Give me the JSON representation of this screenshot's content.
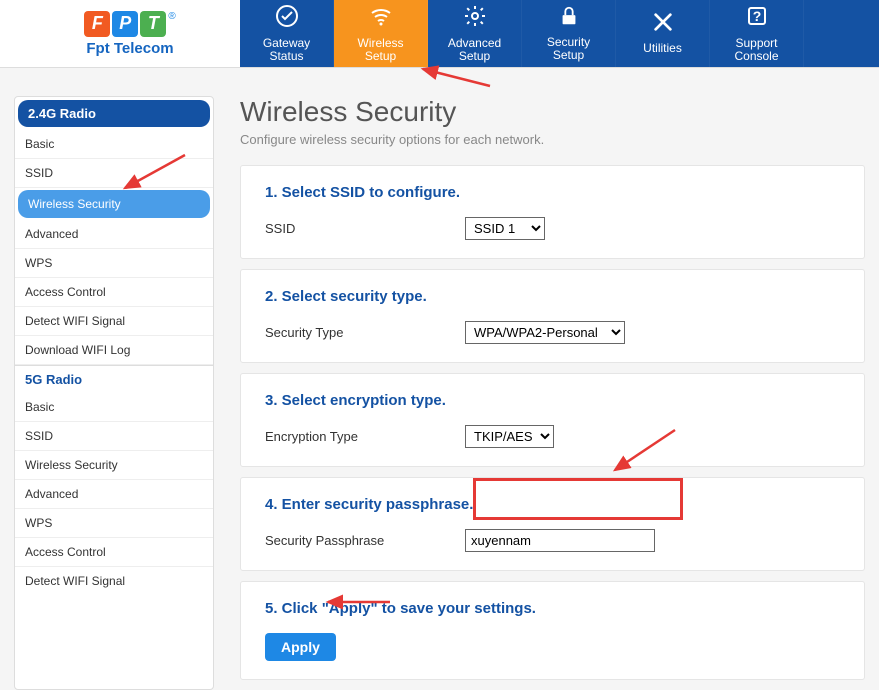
{
  "logo": {
    "letters": [
      "F",
      "P",
      "T"
    ],
    "brand": "Fpt Telecom"
  },
  "topnav": [
    {
      "label": "Gateway\nStatus",
      "icon": "✓"
    },
    {
      "label": "Wireless\nSetup",
      "icon": "wifi"
    },
    {
      "label": "Advanced\nSetup",
      "icon": "⚙"
    },
    {
      "label": "Security\nSetup",
      "icon": "🔒"
    },
    {
      "label": "Utilities",
      "icon": "✕"
    },
    {
      "label": "Support\nConsole",
      "icon": "❓"
    }
  ],
  "sidebar": {
    "g24": {
      "head": "2.4G Radio",
      "items": [
        "Basic",
        "SSID",
        "Wireless Security",
        "Advanced",
        "WPS",
        "Access Control",
        "Detect WIFI Signal",
        "Download WIFI Log"
      ]
    },
    "g5": {
      "head": "5G Radio",
      "items": [
        "Basic",
        "SSID",
        "Wireless Security",
        "Advanced",
        "WPS",
        "Access Control",
        "Detect WIFI Signal"
      ]
    }
  },
  "page": {
    "title": "Wireless Security",
    "sub": "Configure wireless security options for each network."
  },
  "steps": {
    "s1": {
      "title": "1. Select SSID to configure.",
      "label": "SSID",
      "value": "SSID 1"
    },
    "s2": {
      "title": "2. Select security type.",
      "label": "Security Type",
      "value": "WPA/WPA2-Personal"
    },
    "s3": {
      "title": "3. Select encryption type.",
      "label": "Encryption Type",
      "value": "TKIP/AES"
    },
    "s4": {
      "title": "4. Enter security passphrase.",
      "label": "Security Passphrase",
      "value": "xuyennam"
    },
    "s5": {
      "title": "5. Click \"Apply\" to save your settings.",
      "button": "Apply"
    }
  }
}
